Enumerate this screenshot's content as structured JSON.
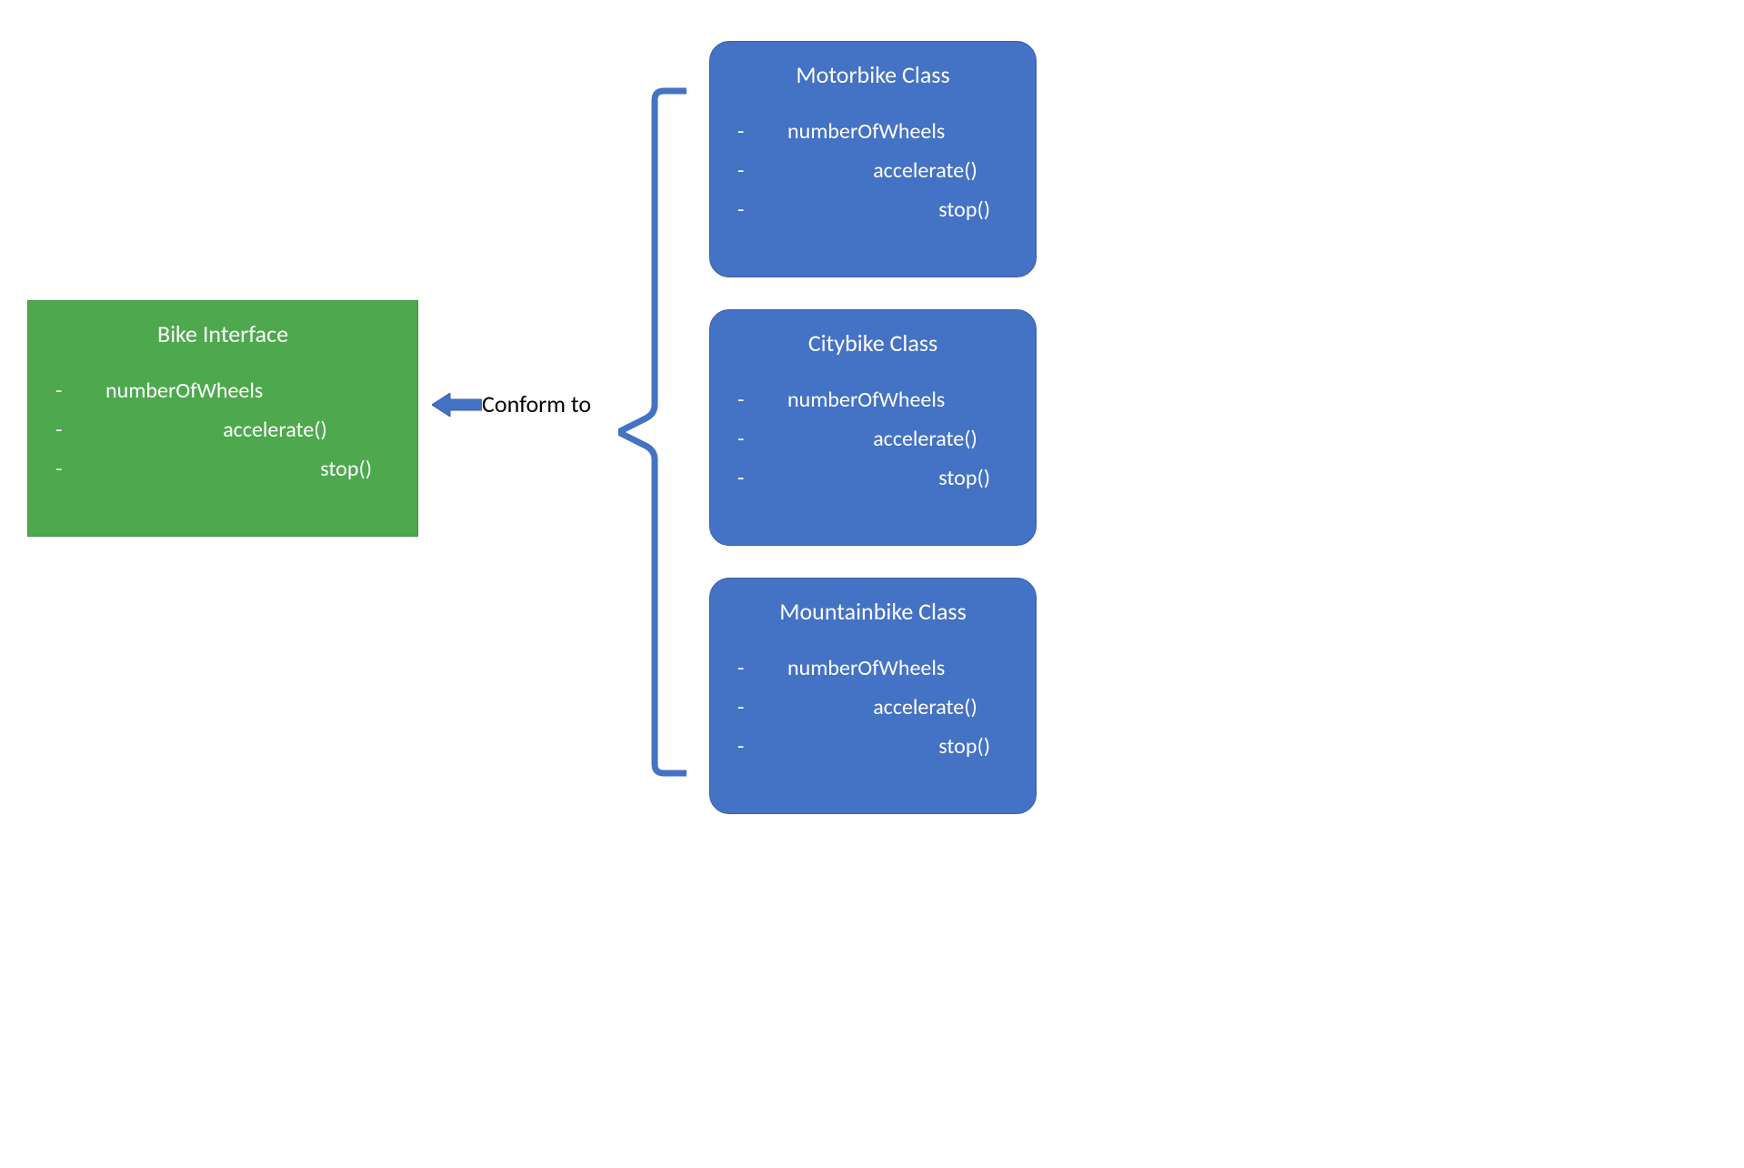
{
  "interface": {
    "title": "Bike Interface",
    "members": [
      "numberOfWheels",
      "accelerate()",
      "stop()"
    ]
  },
  "conform_label": "Conform to",
  "classes": [
    {
      "title": "Motorbike Class",
      "members": [
        "numberOfWheels",
        "accelerate()",
        "stop()"
      ]
    },
    {
      "title": "Citybike Class",
      "members": [
        "numberOfWheels",
        "accelerate()",
        "stop()"
      ]
    },
    {
      "title": "Mountainbike Class",
      "members": [
        "numberOfWheels",
        "accelerate()",
        "stop()"
      ]
    }
  ],
  "colors": {
    "interface_bg": "#4ea84e",
    "class_bg": "#4472c4",
    "connector": "#4472c4"
  }
}
